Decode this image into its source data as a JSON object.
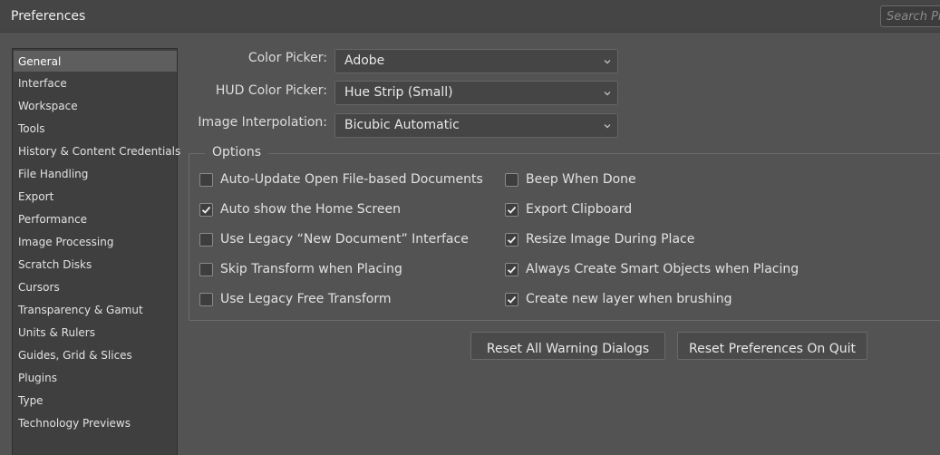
{
  "window": {
    "title": "Preferences",
    "search_placeholder": "Search Preferences"
  },
  "sidebar": {
    "items": [
      {
        "label": "General",
        "active": true
      },
      {
        "label": "Interface"
      },
      {
        "label": "Workspace"
      },
      {
        "label": "Tools"
      },
      {
        "label": "History & Content Credentials"
      },
      {
        "label": "File Handling"
      },
      {
        "label": "Export"
      },
      {
        "label": "Performance"
      },
      {
        "label": "Image Processing"
      },
      {
        "label": "Scratch Disks"
      },
      {
        "label": "Cursors"
      },
      {
        "label": "Transparency & Gamut"
      },
      {
        "label": "Units & Rulers"
      },
      {
        "label": "Guides, Grid & Slices"
      },
      {
        "label": "Plugins"
      },
      {
        "label": "Type"
      },
      {
        "label": "Technology Previews"
      }
    ]
  },
  "fields": {
    "color_picker": {
      "label": "Color Picker:",
      "value": "Adobe"
    },
    "hud_color_picker": {
      "label": "HUD Color Picker:",
      "value": "Hue Strip (Small)"
    },
    "image_interpolation": {
      "label": "Image Interpolation:",
      "value": "Bicubic Automatic"
    }
  },
  "options": {
    "title": "Options",
    "left": [
      {
        "label": "Auto-Update Open File-based Documents",
        "checked": false
      },
      {
        "label": "Auto show the Home Screen",
        "checked": true
      },
      {
        "label": "Use Legacy “New Document” Interface",
        "checked": false
      },
      {
        "label": "Skip Transform when Placing",
        "checked": false
      },
      {
        "label": "Use Legacy Free Transform",
        "checked": false
      }
    ],
    "right": [
      {
        "label": "Beep When Done",
        "checked": false
      },
      {
        "label": "Export Clipboard",
        "checked": true
      },
      {
        "label": "Resize Image During Place",
        "checked": true
      },
      {
        "label": "Always Create Smart Objects when Placing",
        "checked": true
      },
      {
        "label": "Create new layer when brushing",
        "checked": true
      }
    ]
  },
  "buttons": {
    "reset_warnings": "Reset All Warning Dialogs",
    "reset_prefs": "Reset Preferences On Quit"
  },
  "colors": {
    "background": "#535353",
    "sidebar": "#3f3f3f",
    "active_item": "#5e5e5e"
  }
}
